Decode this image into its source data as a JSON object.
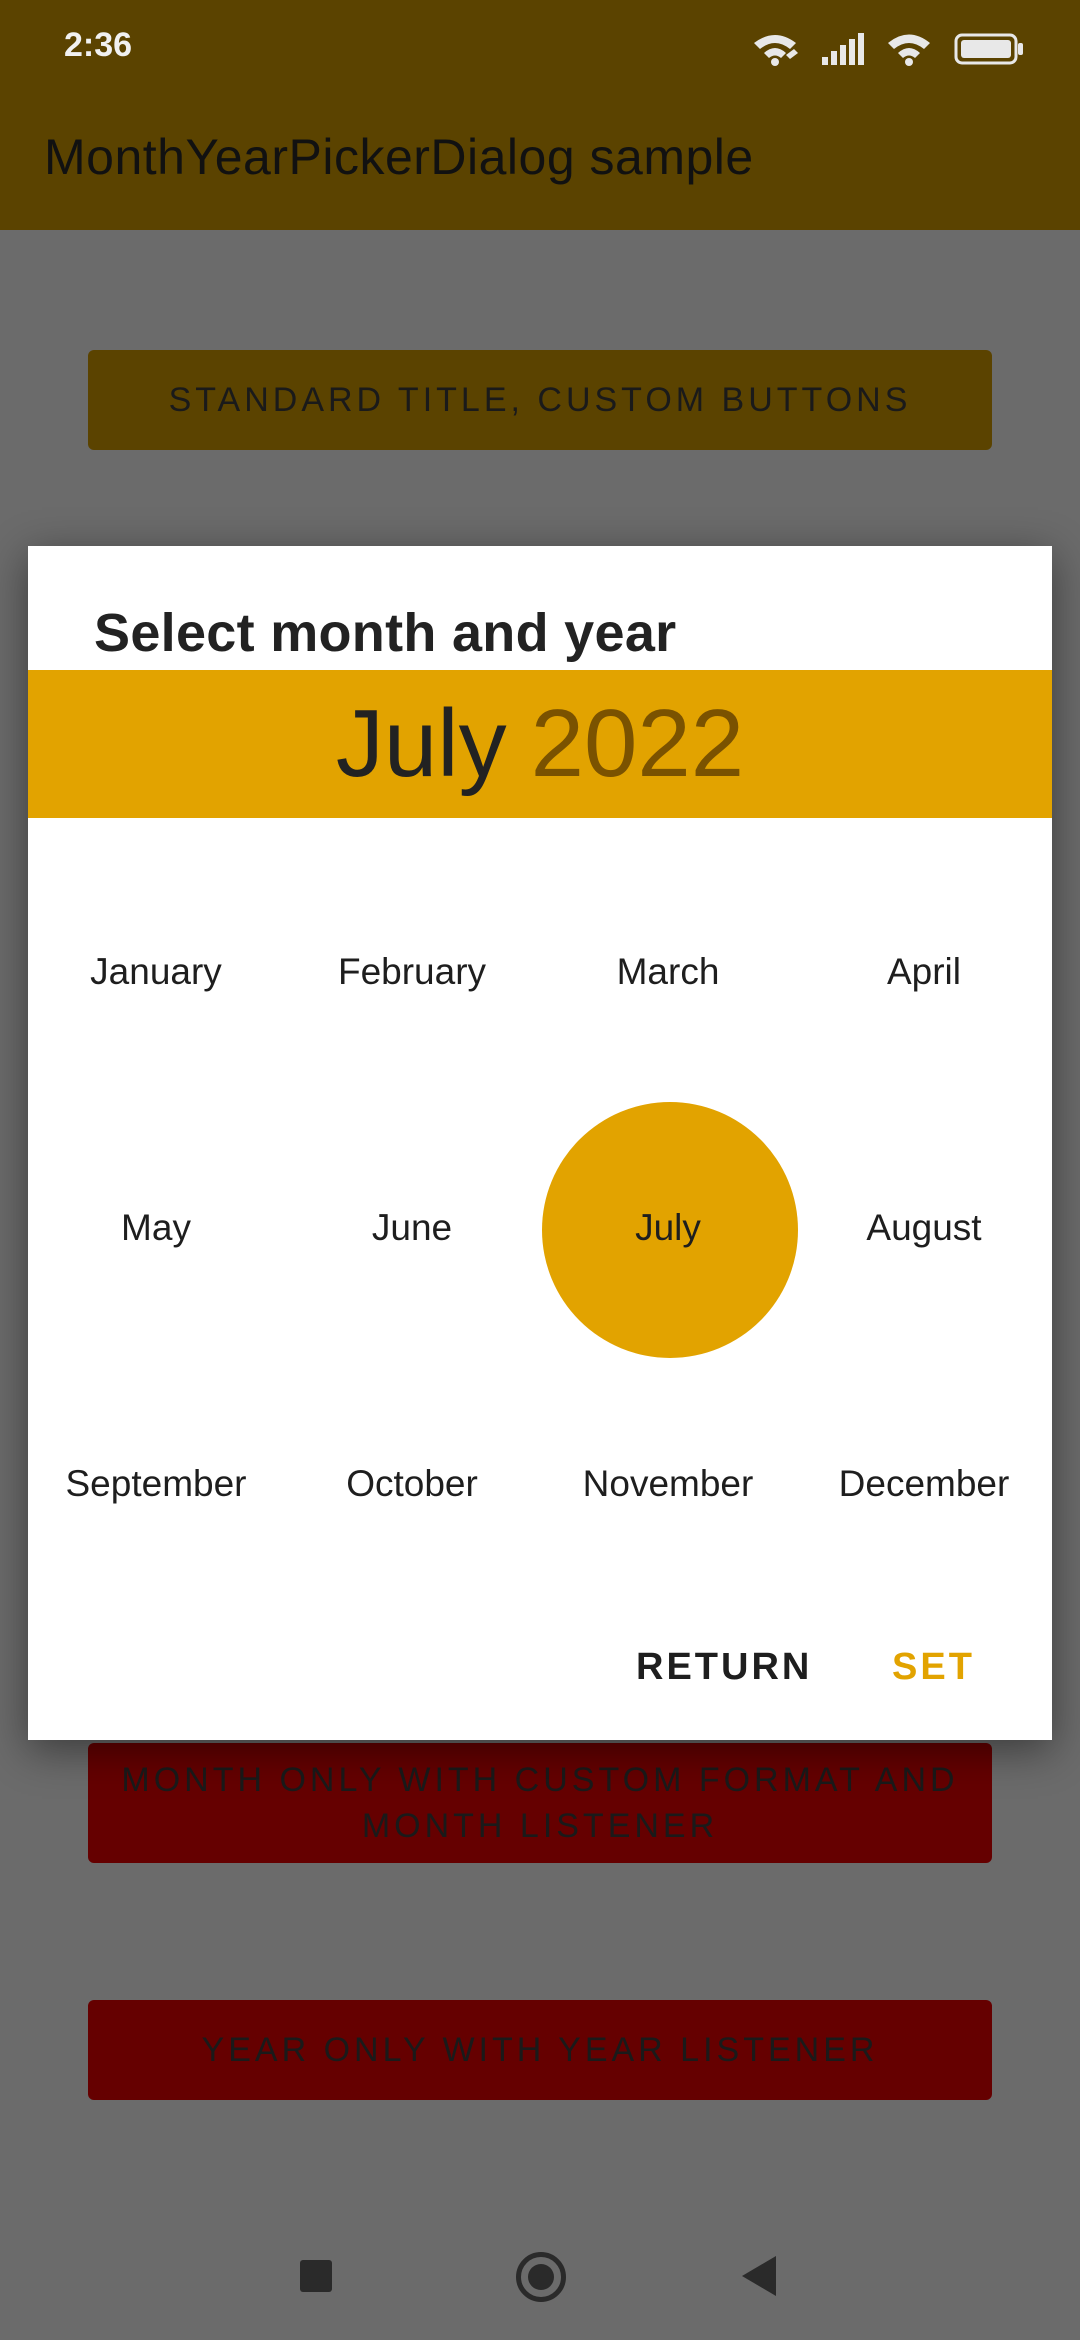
{
  "status_bar": {
    "time": "2:36",
    "icons": [
      "wifi-calling-icon",
      "signal-icon",
      "wifi-icon",
      "battery-icon"
    ]
  },
  "app_bar": {
    "title": "MonthYearPickerDialog sample"
  },
  "buttons": {
    "standard_title": "STANDARD TITLE, CUSTOM BUTTONS",
    "month_only": "MONTH ONLY WITH CUSTOM FORMAT AND MONTH LISTENER",
    "year_only": "YEAR ONLY WITH YEAR LISTENER"
  },
  "dialog": {
    "title": "Select month and year",
    "header": {
      "month": "July",
      "year": "2022"
    },
    "months": [
      "January",
      "February",
      "March",
      "April",
      "May",
      "June",
      "July",
      "August",
      "September",
      "October",
      "November",
      "December"
    ],
    "selected_month": "July",
    "actions": {
      "return": "RETURN",
      "set": "SET"
    }
  },
  "colors": {
    "accent": "#e2a300",
    "appbar": "#5b4300",
    "scrim_background": "#6b6b6b",
    "red_button": "#650000",
    "year_text": "#7a5200"
  },
  "nav_bar": {
    "icons": [
      "recents-square-icon",
      "home-circle-icon",
      "back-triangle-icon"
    ]
  }
}
